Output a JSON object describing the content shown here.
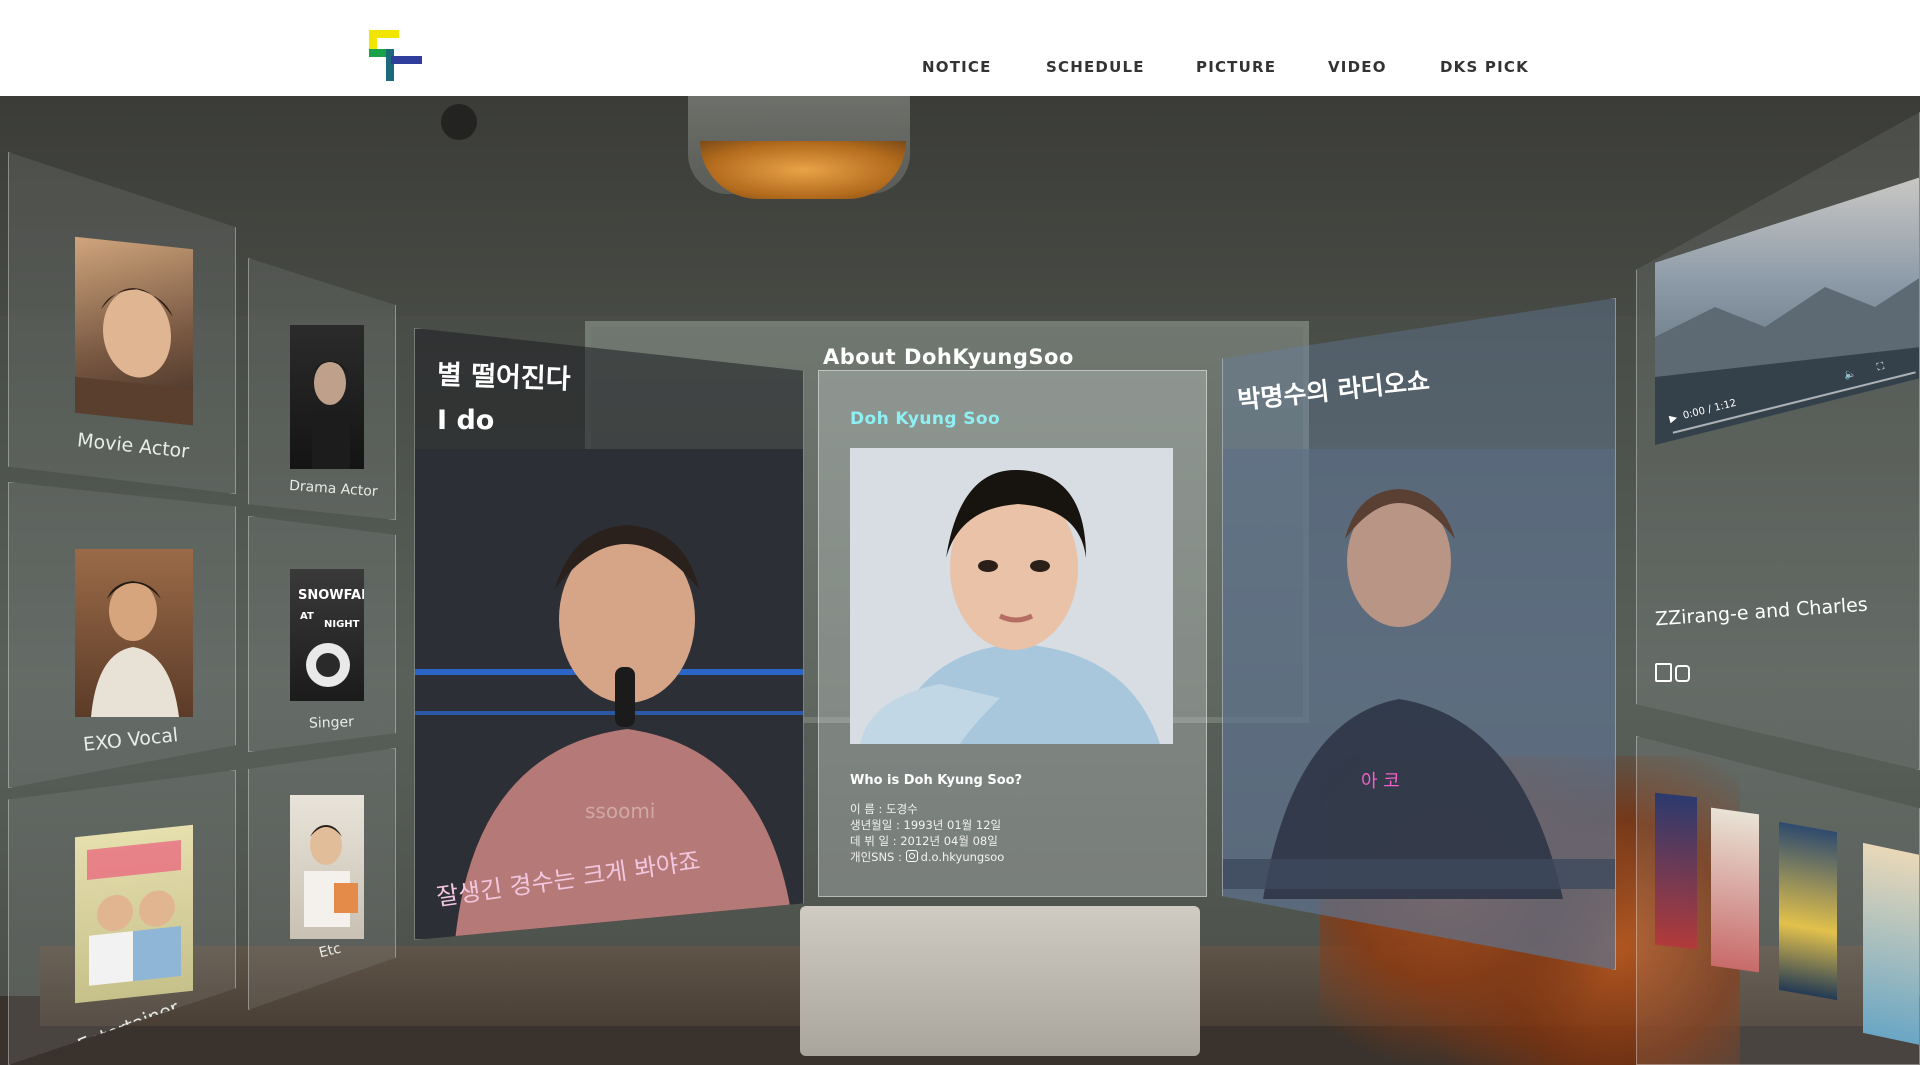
{
  "header": {
    "nav": [
      "NOTICE",
      "SCHEDULE",
      "PICTURE",
      "VIDEO",
      "DKS PICK"
    ]
  },
  "categories": {
    "movie_actor": "Movie Actor",
    "drama_actor": "Drama Actor",
    "exo_vocal": "EXO Vocal",
    "singer": "Singer",
    "entertainer": "Entertainer",
    "etc": "Etc"
  },
  "left_panel": {
    "title_line1": "별 떨어진다",
    "title_line2": "I do",
    "subtitle": "잘생긴 경수는 크게 봐야죠",
    "watermark": "ssoomi"
  },
  "about": {
    "section_title": "About DohKyungSoo",
    "name": "Doh Kyung Soo",
    "question": "Who is Doh Kyung Soo?",
    "info": [
      "이 름 : 도경수",
      "생년월일 : 1993년 01월 12일",
      "데 뷔 일 : 2012년 04월 08일"
    ],
    "sns_label": "개인SNS : ",
    "sns_handle": "d.o.hkyungsoo"
  },
  "right_panel": {
    "title": "박명수의 라디오쇼",
    "caption": "아 코"
  },
  "video": {
    "time": "0:00 / 1:12"
  },
  "zzirang": {
    "title": "ZZirang-e and Charles"
  },
  "colors": {
    "logo_yellow": "#f2e600",
    "logo_green": "#1aa24a",
    "logo_blue": "#2f3d9c",
    "logo_teal": "#1a6a7a",
    "name_accent": "#8ff0f3"
  }
}
